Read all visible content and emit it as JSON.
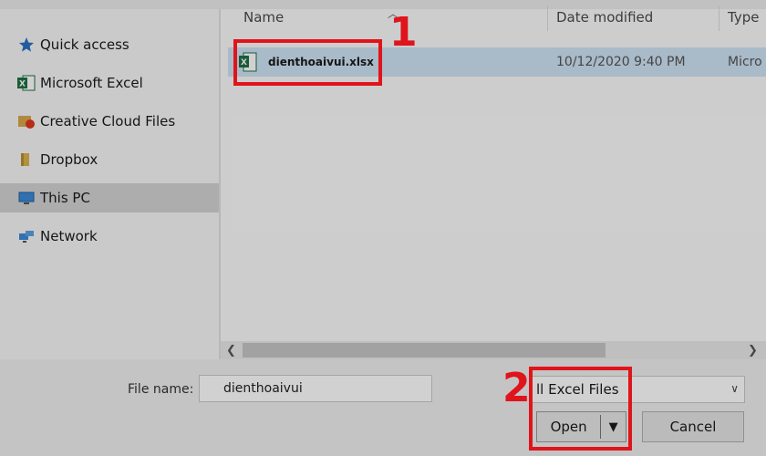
{
  "header": {
    "columns": [
      "Name",
      "Date modified",
      "Type"
    ]
  },
  "sidebar": {
    "items": [
      {
        "label": "Quick access",
        "icon": "star-icon"
      },
      {
        "label": "Microsoft Excel",
        "icon": "excel-icon"
      },
      {
        "label": "Creative Cloud Files",
        "icon": "creative-cloud-icon"
      },
      {
        "label": "Dropbox",
        "icon": "dropbox-folder-icon"
      },
      {
        "label": "This PC",
        "icon": "pc-icon",
        "selected": true
      },
      {
        "label": "Network",
        "icon": "network-icon"
      }
    ]
  },
  "files": [
    {
      "name": "dienthoaivui.xlsx",
      "date": "10/12/2020 9:40 PM",
      "type": "Micro"
    }
  ],
  "footer": {
    "file_name_label": "File name:",
    "file_name_value": "dienthoaivui",
    "filter_label": "ll Excel Files",
    "open_label": "Open",
    "cancel_label": "Cancel"
  },
  "annotations": {
    "step1": "1",
    "step2": "2"
  },
  "colors": {
    "callout": "#e0141b",
    "selection": "#cfe3f5",
    "excel_green": "#1e7145"
  }
}
